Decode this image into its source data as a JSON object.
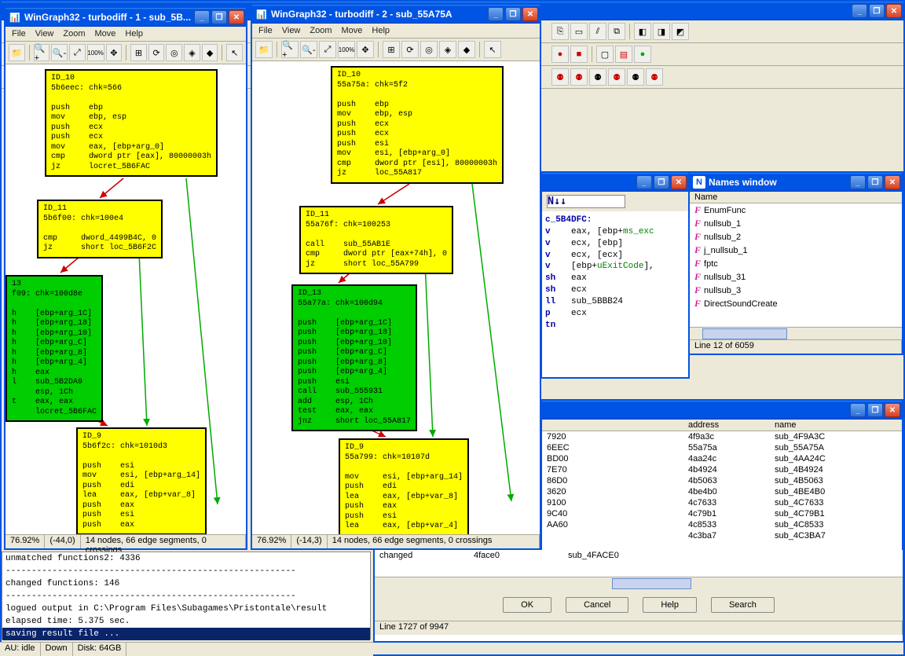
{
  "main_window": {
    "titlebar_buttons": [
      "min",
      "max",
      "close"
    ]
  },
  "wingraph_menu": [
    "File",
    "View",
    "Zoom",
    "Move",
    "Help"
  ],
  "wingraph_status": {
    "zoom": "76.92%",
    "nodes": "14 nodes, 66 edge segments, 0 crossings"
  },
  "win1": {
    "title": "WinGraph32 - turbodiff - 1 - sub_5B...",
    "pos_status": "(-44,0)",
    "nodes": {
      "id10": "ID_10\n5b6eec: chk=566\n\npush    ebp\nmov     ebp, esp\npush    ecx\npush    ecx\nmov     eax, [ebp+arg_0]\ncmp     dword ptr [eax], 80000003h\njz      locret_5B6FAC",
      "id11": "ID_11\n5b6f00: chk=100e4\n\ncmp     dword_4499B4C, 0\njz      short loc_5B6F2C",
      "id13": "13\nf09: chk=100d8e\n\nh    [ebp+arg_1C]\nh    [ebp+arg_18]\nh    [ebp+arg_10]\nh    [ebp+arg_C]\nh    [ebp+arg_8]\nh    [ebp+arg_4]\nh    eax\nl    sub_5B2DA9\n     esp, 1Ch\nt    eax, eax\n     locret_5B6FAC",
      "id9": "ID_9\n5b6f2c: chk=1010d3\n\npush    esi\nmov     esi, [ebp+arg_14]\npush    edi\nlea     eax, [ebp+var_8]\npush    eax\npush    esi\npush    eax"
    }
  },
  "win2": {
    "title": "WinGraph32 - turbodiff - 2 - sub_55A75A",
    "pos_status": "(-14,3)",
    "nodes": {
      "id10": "ID_10\n55a75a: chk=5f2\n\npush    ebp\nmov     ebp, esp\npush    ecx\npush    ecx\npush    esi\nmov     esi, [ebp+arg_0]\ncmp     dword ptr [esi], 80000003h\njz      loc_55A817",
      "id11": "ID_11\n55a76f: chk=100253\n\ncall    sub_55AB1E\ncmp     dword ptr [eax+74h], 0\njz      short loc_55A799",
      "id13": "ID_13\n55a77a: chk=100d94\n\npush    [ebp+arg_1C]\npush    [ebp+arg_18]\npush    [ebp+arg_10]\npush    [ebp+arg_C]\npush    [ebp+arg_8]\npush    [ebp+arg_4]\npush    esi\ncall    sub_555931\nadd     esp, 1Ch\ntest    eax, eax\njnz     short loc_55A817",
      "id9": "ID_9\n55a799: chk=10107d\n\nmov     esi, [ebp+arg_14]\npush    edi\nlea     eax, [ebp+var_8]\npush    eax\npush    esi\nlea     eax, [ebp+var_4]"
    }
  },
  "disasm": {
    "lines": [
      {
        "t": "c",
        "label": "c_5B4DFC:"
      },
      {
        "t": "i",
        "op": "v",
        "args": "    eax, [ebp+",
        "g": "ms_exc",
        "tail": ""
      },
      {
        "t": "i",
        "op": "v",
        "args": "    ecx, [ebp]"
      },
      {
        "t": "i",
        "op": "v",
        "args": "    ecx, [ecx]"
      },
      {
        "t": "i",
        "op": "v",
        "args": "    [ebp+",
        "g": "uExitCode",
        "tail": "],"
      },
      {
        "t": "i",
        "op": "sh",
        "args": "   eax"
      },
      {
        "t": "i",
        "op": "sh",
        "args": "   ecx"
      },
      {
        "t": "i",
        "op": "ll",
        "args": "   sub_5BBB24"
      },
      {
        "t": "i",
        "op": "p",
        "args": "    ecx"
      },
      {
        "t": "i",
        "op": "tn",
        "args": ""
      }
    ]
  },
  "names": {
    "title": "Names window",
    "header": "Name",
    "items": [
      "EnumFunc",
      "nullsub_1",
      "nullsub_2",
      "j_nullsub_1",
      "fptc",
      "nullsub_31",
      "nullsub_3",
      "DirectSoundCreate"
    ],
    "status": "Line 12 of 6059"
  },
  "results_small": {
    "col_addr": "address",
    "col_name": "name",
    "rows": [
      [
        "7920",
        "4f9a3c",
        "sub_4F9A3C"
      ],
      [
        "6EEC",
        "55a75a",
        "sub_55A75A"
      ],
      [
        "BD00",
        "4aa24c",
        "sub_4AA24C"
      ],
      [
        "7E70",
        "4b4924",
        "sub_4B4924"
      ],
      [
        "86D0",
        "4b5063",
        "sub_4B5063"
      ],
      [
        "3620",
        "4be4b0",
        "sub_4BE4B0"
      ],
      [
        "9100",
        "4c7633",
        "sub_4C7633"
      ],
      [
        "9C40",
        "4c79b1",
        "sub_4C79B1"
      ],
      [
        "AA60",
        "4c8533",
        "sub_4C8533"
      ],
      [
        "",
        "4c3ba7",
        "sub_4C3BA7"
      ]
    ]
  },
  "results_big": {
    "rows": [
      [
        "changed",
        "4face0",
        "sub_4FACE0"
      ]
    ],
    "buttons": {
      "ok": "OK",
      "cancel": "Cancel",
      "help": "Help",
      "search": "Search"
    },
    "status": "Line 1727 of 9947"
  },
  "output": {
    "l1": "unmatched functions2: 4336",
    "l2": "changed functions: 146",
    "l3": "logued output in C:\\Program Files\\Subagames\\Pristontale\\result",
    "l4": "elapsed time: 5.375 sec.",
    "l5": "saving result file ..."
  },
  "bottom_status": {
    "au": "AU: idle",
    "down": "Down",
    "disk": "Disk: 64GB"
  },
  "jumpbar": "N↓↓"
}
